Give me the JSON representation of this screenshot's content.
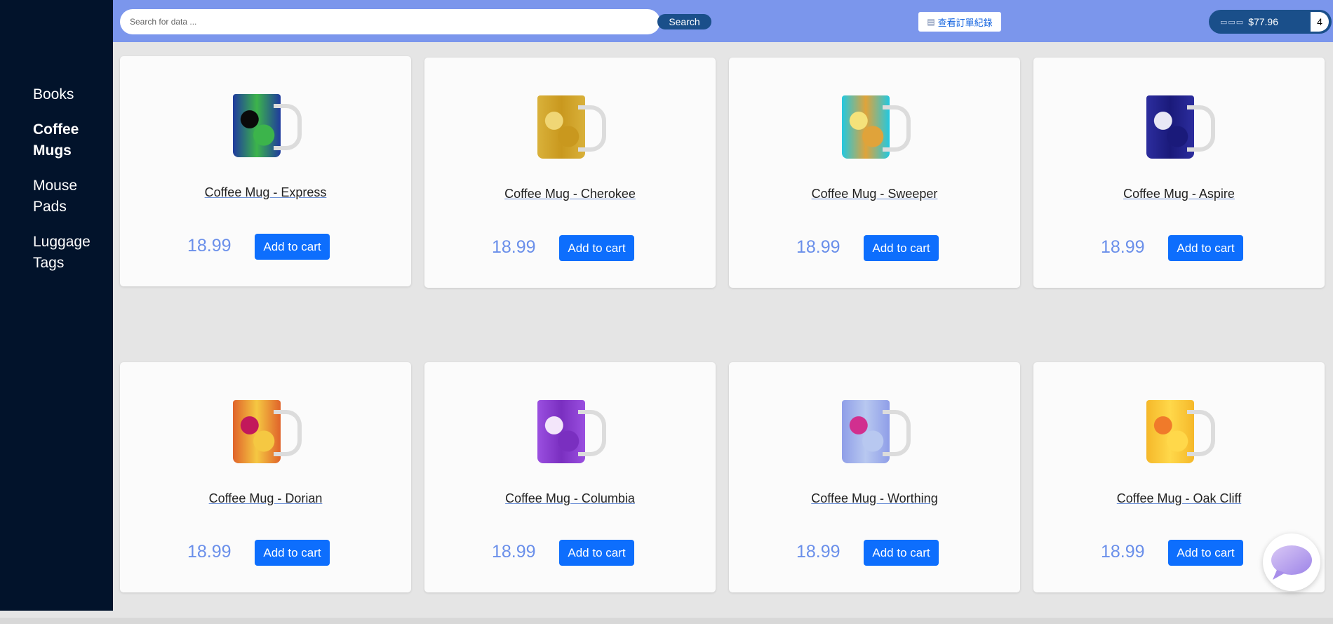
{
  "sidebar": {
    "items": [
      {
        "label": "Books",
        "active": false
      },
      {
        "label": "Coffee Mugs",
        "active": true
      },
      {
        "label": "Mouse Pads",
        "active": false
      },
      {
        "label": "Luggage Tags",
        "active": false
      }
    ]
  },
  "topbar": {
    "search_placeholder": "Search for data ...",
    "search_label": "Search",
    "orders_label": "查看訂單紀錄",
    "cart_total": "$77.96",
    "cart_count": "4",
    "colors": {
      "bar": "#7b96ec",
      "pill": "#1a4f8a"
    }
  },
  "products": [
    {
      "name": "Coffee Mug - Express",
      "price": "18.99",
      "button": "Add to cart",
      "colors": [
        "#1f3a9e",
        "#0a0a0a",
        "#3cb44b"
      ]
    },
    {
      "name": "Coffee Mug - Cherokee",
      "price": "18.99",
      "button": "Add to cart",
      "colors": [
        "#d9b13a",
        "#f0d675",
        "#c9981e"
      ]
    },
    {
      "name": "Coffee Mug - Sweeper",
      "price": "18.99",
      "button": "Add to cart",
      "colors": [
        "#22c8e0",
        "#f5e27a",
        "#e0a33a"
      ]
    },
    {
      "name": "Coffee Mug - Aspire",
      "price": "18.99",
      "button": "Add to cart",
      "colors": [
        "#2c2d9e",
        "#e8e8f5",
        "#1a1a7a"
      ]
    },
    {
      "name": "Coffee Mug - Dorian",
      "price": "18.99",
      "button": "Add to cart",
      "colors": [
        "#e0632a",
        "#c2185b",
        "#f5c842"
      ]
    },
    {
      "name": "Coffee Mug - Columbia",
      "price": "18.99",
      "button": "Add to cart",
      "colors": [
        "#9a4fe0",
        "#f3e6fa",
        "#7a2fc0"
      ]
    },
    {
      "name": "Coffee Mug - Worthing",
      "price": "18.99",
      "button": "Add to cart",
      "colors": [
        "#8f9ee8",
        "#d12f8f",
        "#b8c8f0"
      ]
    },
    {
      "name": "Coffee Mug - Oak Cliff",
      "price": "18.99",
      "button": "Add to cart",
      "colors": [
        "#f5b82a",
        "#f07a2a",
        "#ffd84a"
      ]
    }
  ],
  "chat": {
    "icon": "chat-bubble-icon"
  }
}
